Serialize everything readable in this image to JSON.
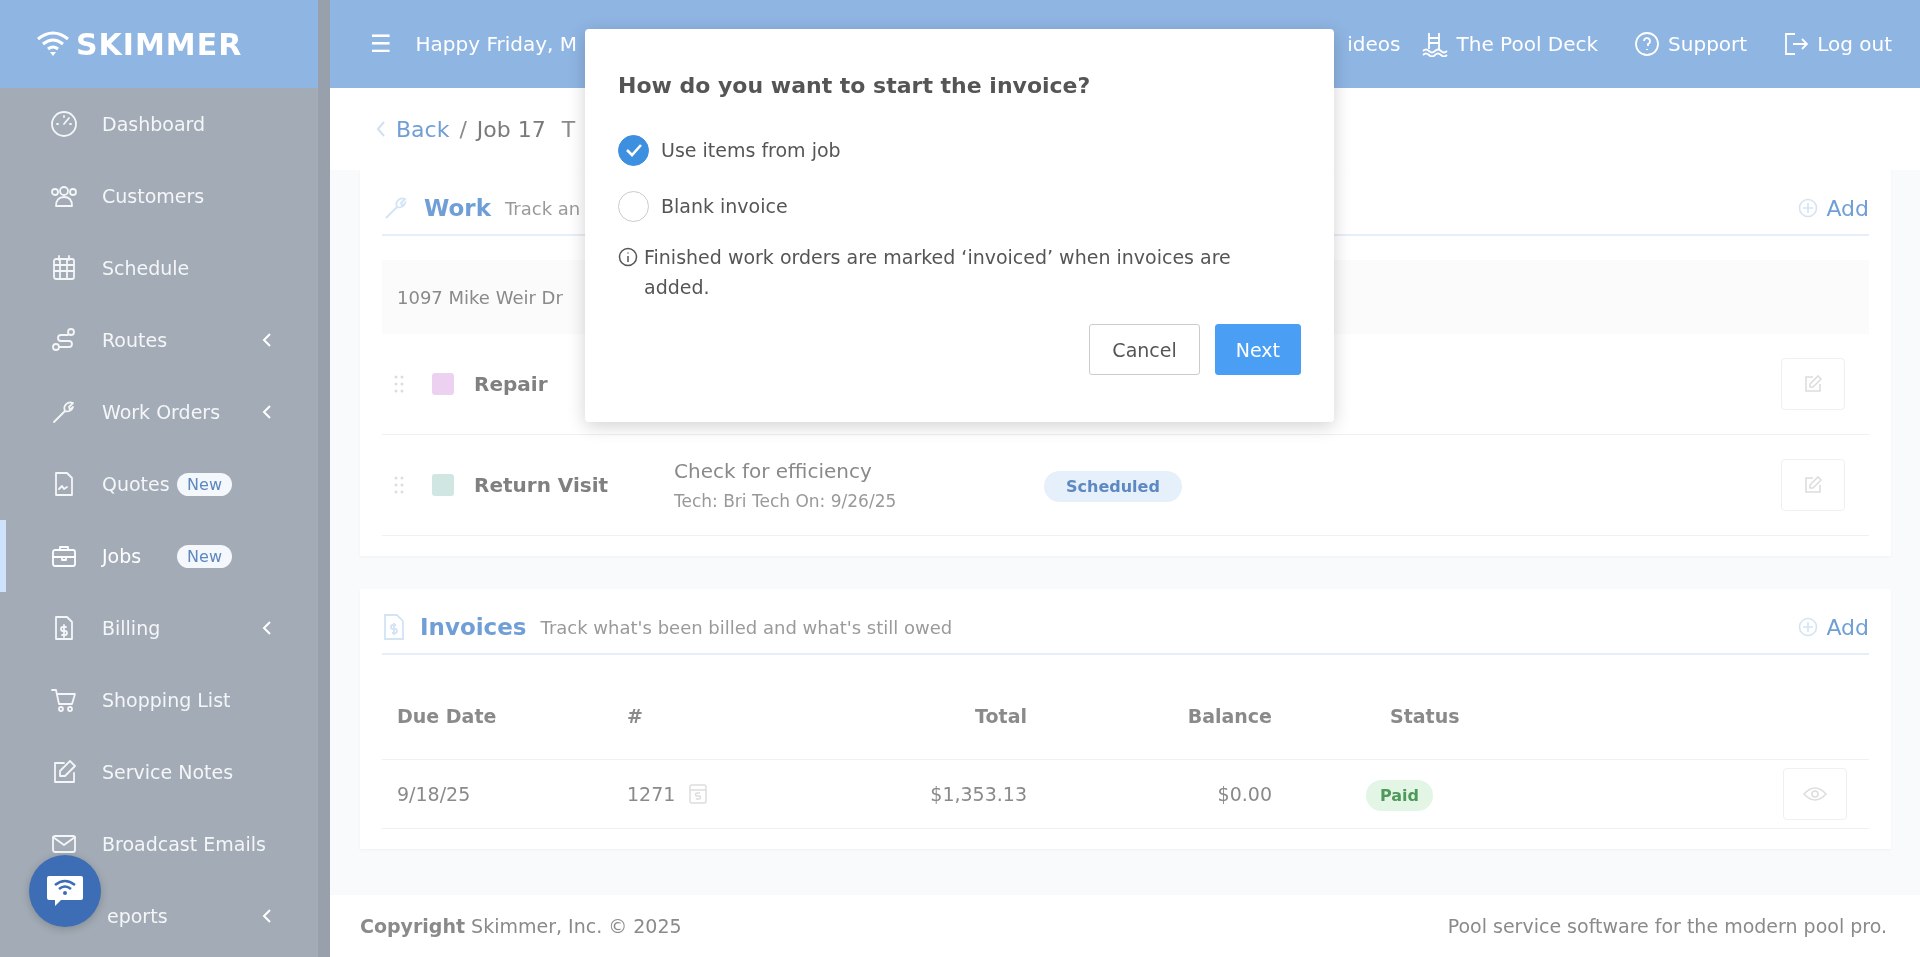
{
  "topbar": {
    "logo": "SKIMMER",
    "menu": "☰",
    "greeting": "Happy Friday, M",
    "links": [
      {
        "label": "ideos"
      },
      {
        "label": "The Pool Deck"
      },
      {
        "label": "Support"
      },
      {
        "label": "Log out"
      }
    ]
  },
  "sidebar": {
    "items": [
      {
        "label": "Dashboard",
        "selected": false,
        "expandable": false
      },
      {
        "label": "Customers",
        "selected": false,
        "expandable": false
      },
      {
        "label": "Schedule",
        "selected": false,
        "expandable": false
      },
      {
        "label": "Routes",
        "selected": false,
        "expandable": true
      },
      {
        "label": "Work Orders",
        "selected": false,
        "expandable": true
      },
      {
        "label": "Quotes",
        "selected": false,
        "expandable": false,
        "badge": "New"
      },
      {
        "label": "Jobs",
        "selected": true,
        "expandable": false,
        "badge": "New"
      },
      {
        "label": "Billing",
        "selected": false,
        "expandable": true
      },
      {
        "label": "Shopping List",
        "selected": false,
        "expandable": false
      },
      {
        "label": "Service Notes",
        "selected": false,
        "expandable": false
      },
      {
        "label": "Broadcast Emails",
        "selected": false,
        "expandable": false
      },
      {
        "label": "eports",
        "selected": false,
        "expandable": true
      }
    ]
  },
  "breadcrumb": {
    "back": "Back",
    "separator": "/",
    "current": "Job 17",
    "title": "T"
  },
  "work": {
    "title": "Work",
    "subtitle": "Track an",
    "add": "Add",
    "address": "1097 Mike Weir Dr",
    "rows": [
      {
        "name": "Repair",
        "color": "#ecd2f0"
      },
      {
        "name": "Return Visit",
        "color": "#cfe6e2",
        "description": "Check for efficiency",
        "detail": "Tech: Bri Tech On: 9/26/25",
        "status": "Scheduled"
      }
    ]
  },
  "invoices": {
    "title": "Invoices",
    "subtitle": "Track what's been billed and what's still owed",
    "add": "Add",
    "columns": [
      "Due Date",
      "#",
      "Total",
      "Balance",
      "Status"
    ],
    "rows": [
      {
        "due": "9/18/25",
        "number": "1271",
        "total": "$1,353.13",
        "balance": "$0.00",
        "status": "Paid"
      }
    ]
  },
  "footer": {
    "copyright": "**Copyright** Skimmer, Inc. © 2025",
    "tagline": "Pool service software for the modern pool pro."
  },
  "dialog": {
    "title": "How do you want to start the invoice?",
    "options": [
      {
        "label": "Use items from job",
        "selected": true
      },
      {
        "label": "Blank invoice",
        "selected": false
      }
    ],
    "note": "Finished work orders are marked ‘invoiced’ when invoices are added.",
    "buttons": [
      {
        "label": "Cancel",
        "kind": "secondary"
      },
      {
        "label": "Next",
        "kind": "primary"
      }
    ]
  }
}
